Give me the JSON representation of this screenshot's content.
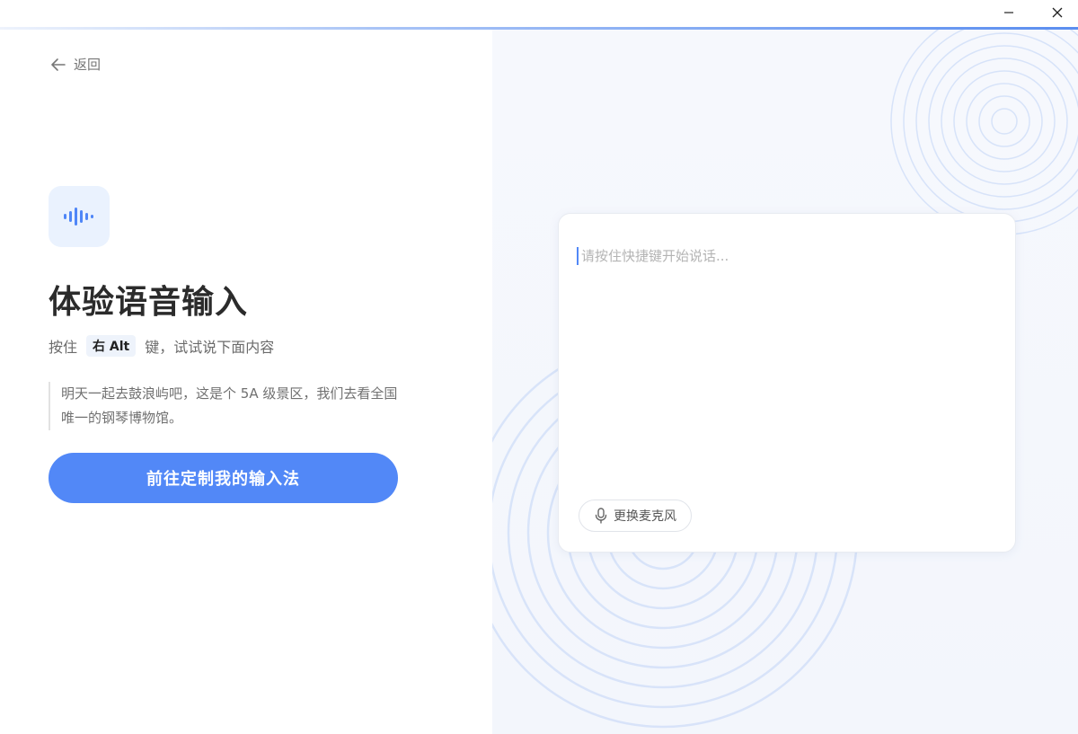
{
  "window": {
    "minimize_icon": "minimize-icon",
    "close_icon": "close-icon"
  },
  "left": {
    "back_label": "返回",
    "heading": "体验语音输入",
    "hint_prefix": "按住",
    "hint_key": "右 Alt",
    "hint_suffix": "键，试试说下面内容",
    "sample_text": "明天一起去鼓浪屿吧，这是个 5A 级景区，我们去看全国唯一的钢琴博物馆。",
    "cta_label": "前往定制我的输入法"
  },
  "right": {
    "placeholder": "请按住快捷键开始说话...",
    "mic_button_label": "更换麦克风"
  },
  "colors": {
    "accent": "#5288f7",
    "icon_bg": "#eaf2fe",
    "right_bg": "#f5f7fd"
  }
}
